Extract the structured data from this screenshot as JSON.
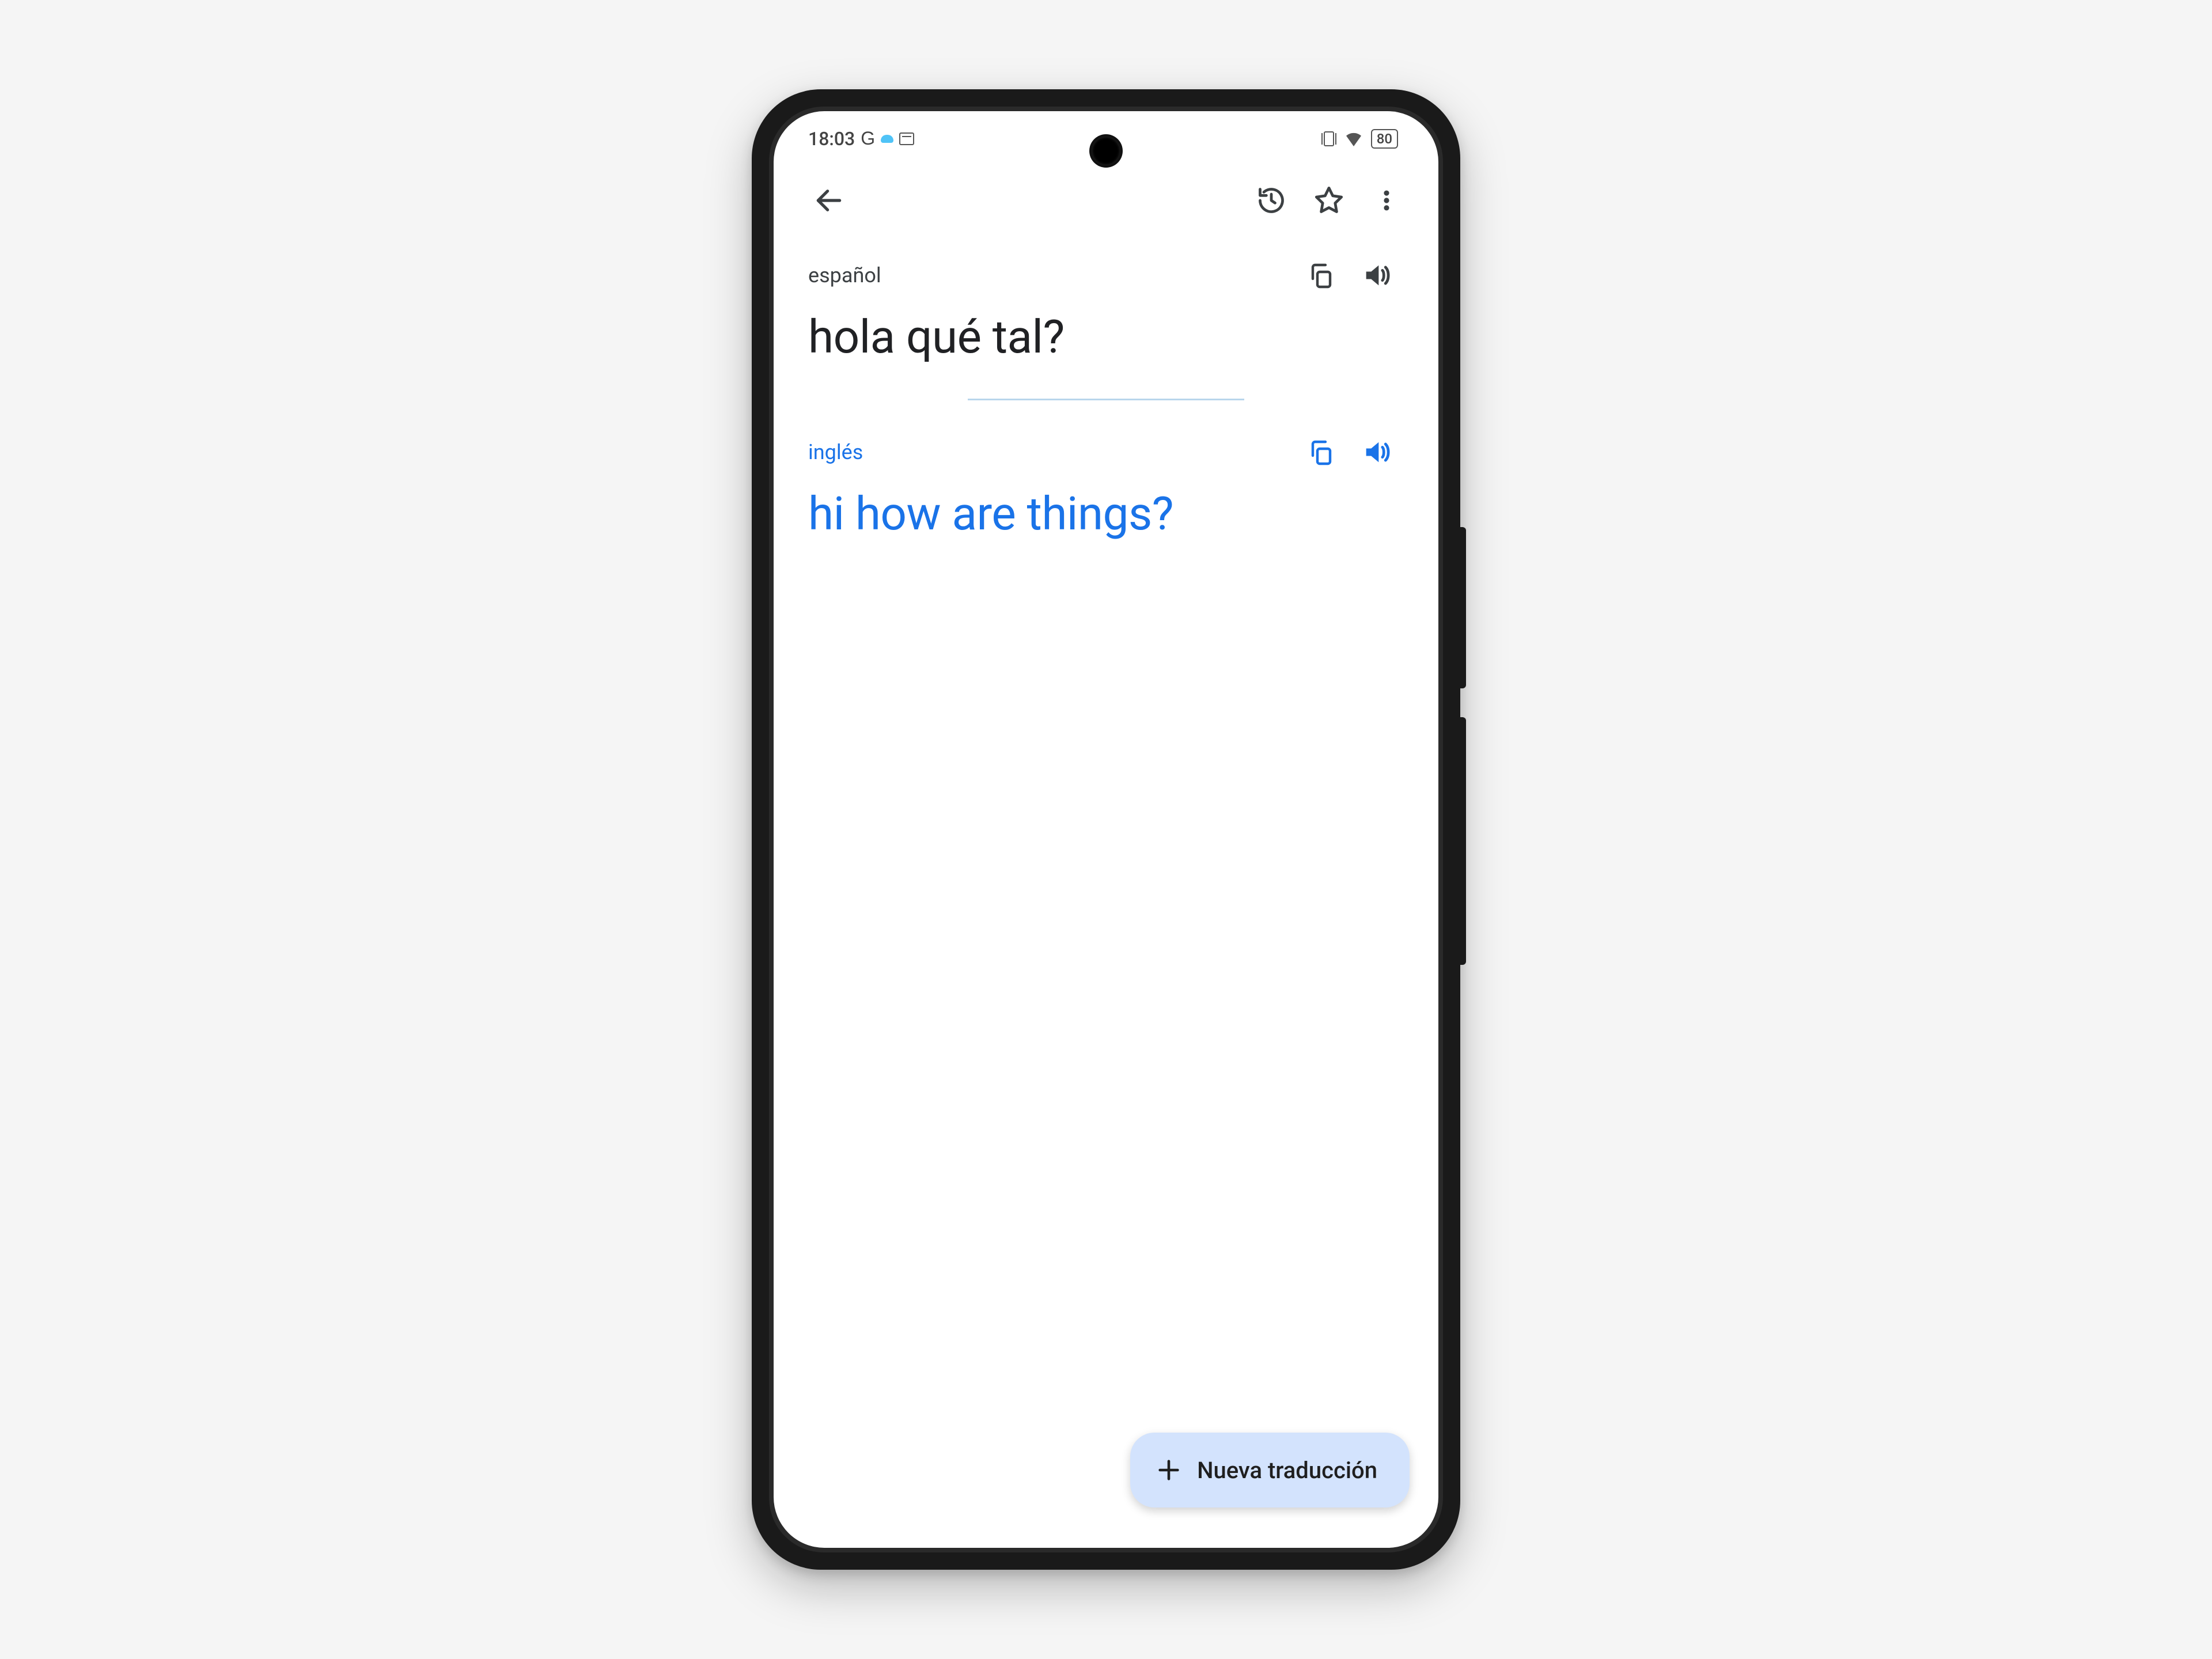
{
  "status": {
    "time": "18:03",
    "google_indicator": "G",
    "battery": "80"
  },
  "source": {
    "language": "español",
    "text": "hola qué tal?"
  },
  "target": {
    "language": "inglés",
    "text": "hi how are things?"
  },
  "fab": {
    "label": "Nueva traducción"
  },
  "colors": {
    "accent": "#1a73e8",
    "fab_bg": "#d3e3fd"
  }
}
